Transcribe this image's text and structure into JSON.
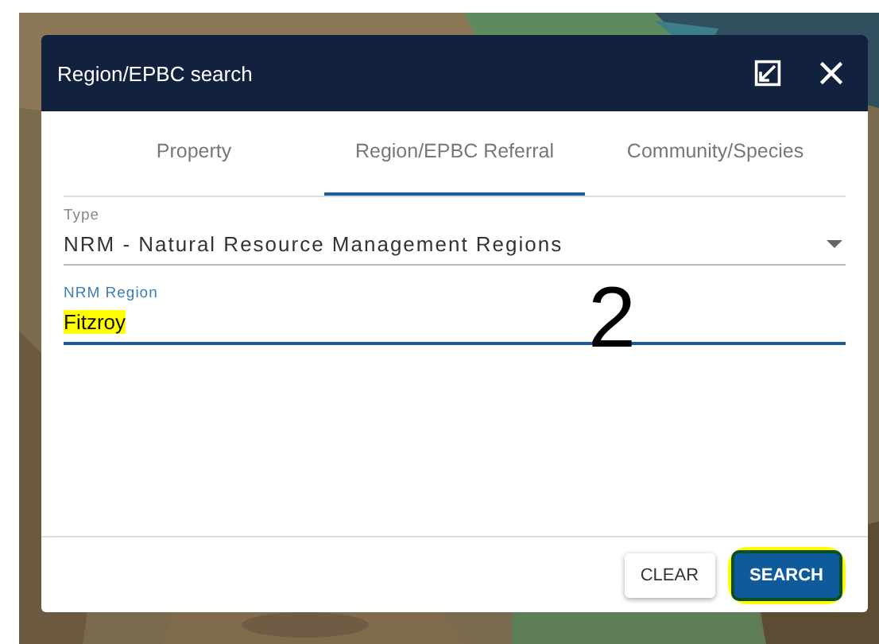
{
  "dialog": {
    "title": "Region/EPBC search"
  },
  "tabs": [
    {
      "label": "Property",
      "selected": false
    },
    {
      "label": "Region/EPBC Referral",
      "selected": true
    },
    {
      "label": "Community/Species",
      "selected": false
    }
  ],
  "type_field": {
    "label": "Type",
    "value": "NRM - Natural Resource Management Regions"
  },
  "region_field": {
    "label": "NRM Region",
    "value": "Fitzroy",
    "focused": true,
    "highlighted": true
  },
  "buttons": [
    {
      "label": "CLEAR",
      "kind": "plain",
      "highlighted": false
    },
    {
      "label": "SEARCH",
      "kind": "primary",
      "highlighted": true
    }
  ],
  "annotation": {
    "label": "2"
  }
}
